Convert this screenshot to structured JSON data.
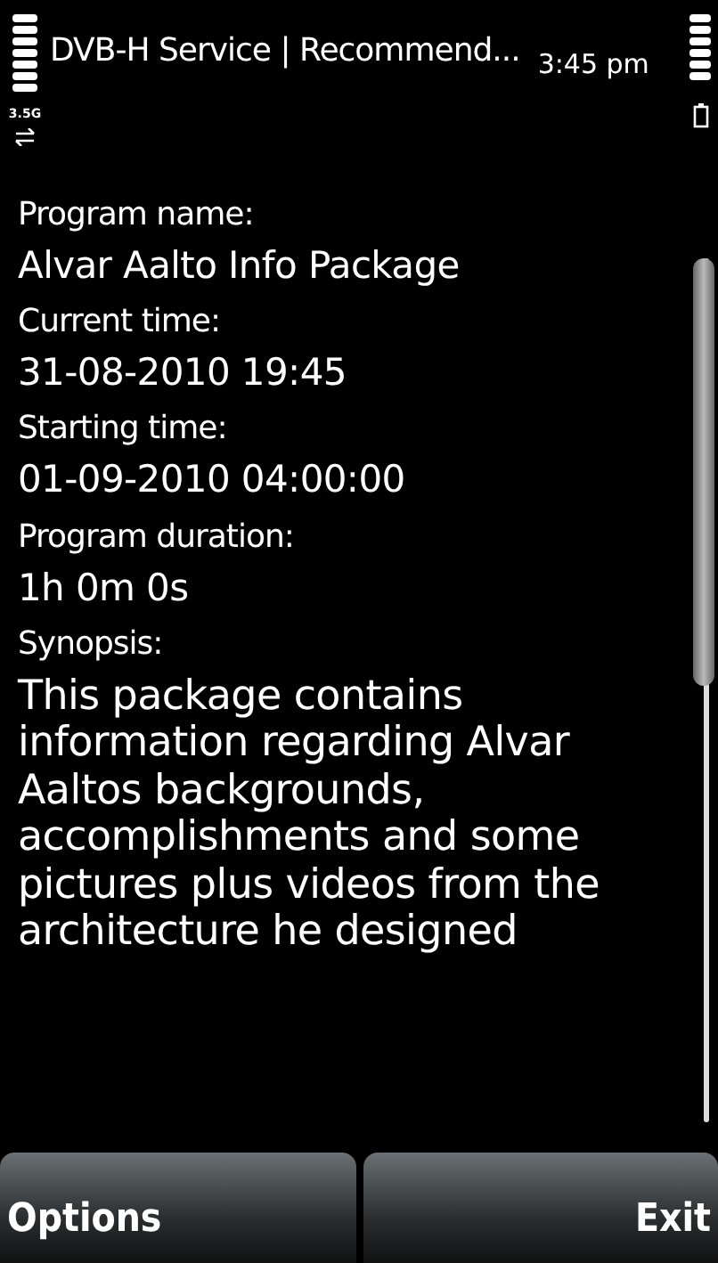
{
  "status_bar": {
    "title": "DVB-H Service | Recommend...",
    "time": "3:45 pm",
    "network_type": "3.5G"
  },
  "fields": [
    {
      "label": "Program name:",
      "value": "Alvar Aalto Info Package"
    },
    {
      "label": "Current time:",
      "value": "31-08-2010 19:45"
    },
    {
      "label": "Starting time:",
      "value": "01-09-2010 04:00:00"
    },
    {
      "label": "Program duration:",
      "value": "1h 0m 0s"
    },
    {
      "label": "Synopsis:",
      "value": "This package contains information regarding Alvar Aaltos backgrounds, accomplishments and some pictures plus videos from the architecture he designed"
    }
  ],
  "softkeys": [
    {
      "label": "Options"
    },
    {
      "label": "Exit"
    }
  ]
}
